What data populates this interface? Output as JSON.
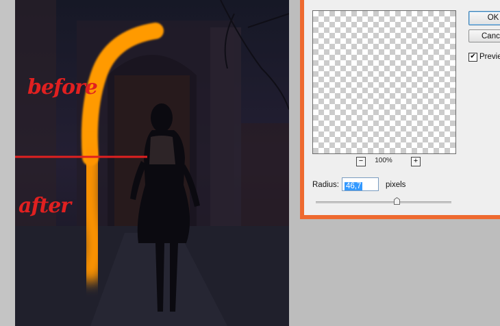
{
  "annotations": {
    "before": "before",
    "after": "after"
  },
  "dialog": {
    "ok_label": "OK",
    "cancel_label": "Cance",
    "preview_label": "Preview",
    "preview_checked": true,
    "zoom_out_label": "−",
    "zoom_in_label": "+",
    "zoom_level": "100%",
    "radius_label": "Radius:",
    "radius_value": "46,7",
    "units_label": "pixels",
    "slider_level_fraction": 0.6
  },
  "colors": {
    "accent_frame": "#ee6a30",
    "annotation_red": "#e02020",
    "brush_orange": "#ff9a00",
    "selection_blue": "#3399ff"
  }
}
